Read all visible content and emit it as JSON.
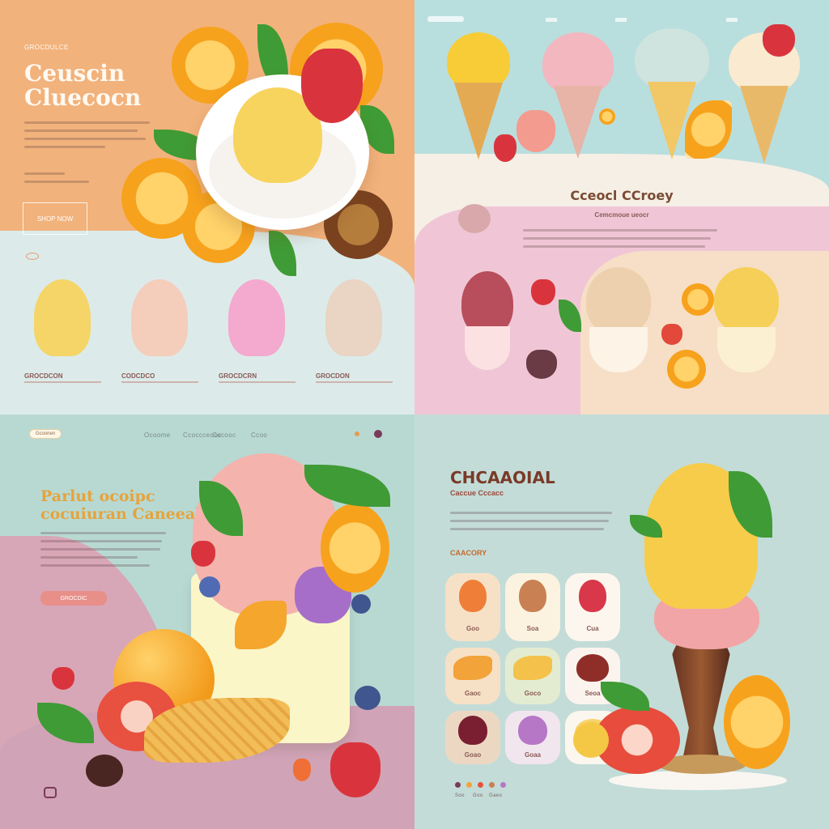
{
  "q1": {
    "kicker": "GROCDULCE",
    "title_line1": "Ceuscin",
    "title_line2": "Cluecocn",
    "cta": "SHOP NOW",
    "product_labels": [
      "GROCDCON",
      "CODCDCO",
      "GROCDCRN",
      "GROCDON"
    ]
  },
  "q2": {
    "heading": "Cceocl CCroey",
    "subheading": "Cemcmoue ueocr"
  },
  "q3": {
    "badge": "Gcoonen",
    "nav": [
      "Ocoome",
      "Ccoccceooc",
      "Cocooc",
      "Ccoo"
    ],
    "title_line1": "Parlut ocoipc",
    "title_line2": "cocuiuran Caneeall",
    "cta_label": "GROCDIC"
  },
  "q4": {
    "title": "CHCAAOIAL",
    "subtitle": "Caccue Cccacc",
    "section_label": "CAACORY",
    "grid_labels": [
      "Goo",
      "Soa",
      "Cua",
      "Gaoc",
      "Goco",
      "Seoa",
      "Goao",
      "Goaa",
      ""
    ],
    "footer": [
      "Soo",
      "Goo",
      "Gaeo"
    ]
  },
  "colors": {
    "peach": "#f2b27c",
    "mint": "#b9dede",
    "sage": "#b8d9d2",
    "pink": "#e7a6b5",
    "cream": "#fff6e4",
    "chocolate": "#6e2f25"
  }
}
